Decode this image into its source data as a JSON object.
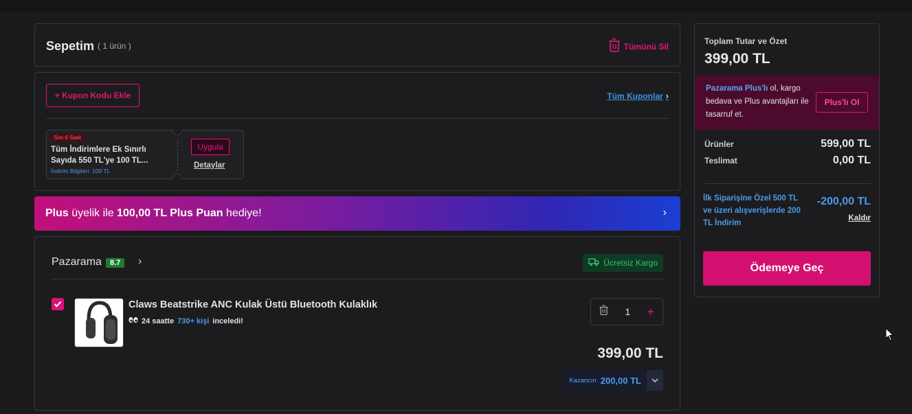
{
  "cart": {
    "title": "Sepetim",
    "count": "( 1 ürün )",
    "delete_all": "Tümünü Sil"
  },
  "coupon": {
    "add": "+ Kupon Kodu Ekle",
    "all_coupons": "Tüm Kuponlar",
    "ticket": {
      "badge": "Son 6 Saat",
      "line1": "Tüm İndirimlere Ek Sınırlı",
      "line2": "Sayıda 550 TL'ye 100 TL...",
      "info_label": "İndirim Bilgileri:",
      "info_value": "100 TL",
      "apply": "Uygula",
      "details": "Detaylar"
    }
  },
  "banner": {
    "p1": "Plus",
    "p2": " üyelik ile ",
    "p3": "100,00 TL Plus Puan",
    "p4": " hediye!"
  },
  "seller": {
    "name": "Pazarama",
    "rating": "8.7",
    "free_shipping": "Ücretsiz Kargo",
    "product": {
      "name": "Claws Beatstrike ANC Kulak Üstü Bluetooth Kulaklık",
      "views_pre": "24 saatte",
      "views_num": "730+ kişi",
      "views_post": "inceledi!",
      "qty": "1",
      "price": "399,00 TL",
      "earn_label": "Kazancın",
      "earn_value": "200,00 TL"
    }
  },
  "summary": {
    "title": "Toplam Tutar ve Özet",
    "total": "399,00 TL",
    "plus_brand": "Pazarama Plus'lı",
    "plus_rest": " ol, kargo bedava ve Plus avantajları ile tasarruf et.",
    "plus_btn": "Plus'lı Ol",
    "products_label": "Ürünler",
    "products_value": "599,00 TL",
    "delivery_label": "Teslimat",
    "delivery_value": "0,00 TL",
    "discount_text": "İlk Siparişine Özel 500 TL ve üzeri alışverişlerde 200 TL İndirim",
    "discount_value": "-200,00 TL",
    "remove": "Kaldır",
    "checkout": "Ödemeye Geç"
  },
  "colors": {
    "accent": "#e3147a",
    "link": "#4b9bea",
    "bg": "#1b1b1d"
  }
}
